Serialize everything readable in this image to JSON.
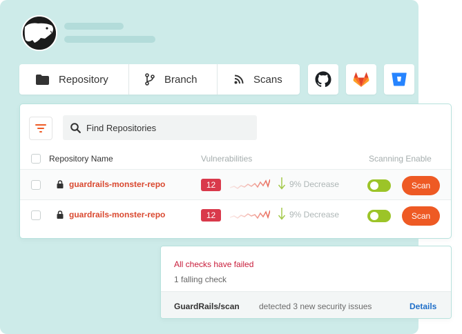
{
  "tabs": [
    {
      "label": "Repository",
      "icon": "folder-icon"
    },
    {
      "label": "Branch",
      "icon": "branch-icon"
    },
    {
      "label": "Scans",
      "icon": "rss-icon"
    }
  ],
  "providers": [
    {
      "name": "github-icon"
    },
    {
      "name": "gitlab-icon"
    },
    {
      "name": "bitbucket-icon"
    }
  ],
  "search": {
    "placeholder": "Find Repositories"
  },
  "table": {
    "headers": {
      "name": "Repository Name",
      "vulnerabilities": "Vulnerabilities",
      "scanning": "Scanning Enable"
    },
    "rows": [
      {
        "name": "guardrails-monster-repo",
        "vulnerabilities": "12",
        "trend": "9% Decrease",
        "scanning_enabled": true,
        "action": "Scan"
      },
      {
        "name": "guardrails-monster-repo",
        "vulnerabilities": "12",
        "trend": "9% Decrease",
        "scanning_enabled": true,
        "action": "Scan"
      }
    ]
  },
  "checks": {
    "status": "All checks have failed",
    "count": "1 falling check",
    "check_name": "GuardRails/scan",
    "description": "detected 3 new security issues",
    "details_label": "Details"
  },
  "colors": {
    "panel_bg": "#cdebe9",
    "accent": "#ee5a24",
    "repo_link": "#d9482f",
    "danger_badge": "#d9394b",
    "toggle_on": "#9cc428",
    "failed_text": "#c81c3a",
    "details_link": "#1f6fc9"
  }
}
